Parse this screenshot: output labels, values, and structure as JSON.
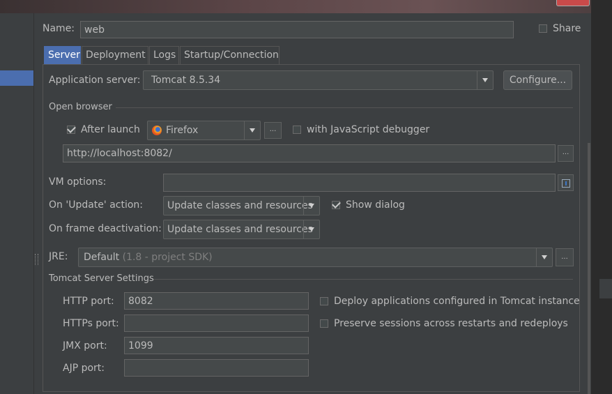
{
  "name_field": {
    "label": "Name:",
    "value": "web"
  },
  "share": {
    "label": "Share",
    "checked": false
  },
  "tabs": [
    {
      "label": "Server",
      "active": true
    },
    {
      "label": "Deployment",
      "active": false
    },
    {
      "label": "Logs",
      "active": false
    },
    {
      "label": "Startup/Connection",
      "active": false
    }
  ],
  "app_server": {
    "label": "Application server:",
    "value": "Tomcat 8.5.34",
    "configure_label": "Configure..."
  },
  "open_browser": {
    "section_title": "Open browser",
    "after_launch_label": "After launch",
    "after_launch_checked": true,
    "browser": "Firefox",
    "ellipsis": "...",
    "js_debugger_label": "with JavaScript debugger",
    "js_debugger_checked": false,
    "url": "http://localhost:8082/"
  },
  "vm_options": {
    "label": "VM options:",
    "value": ""
  },
  "on_update": {
    "label": "On 'Update' action:",
    "value": "Update classes and resources",
    "show_dialog_label": "Show dialog",
    "show_dialog_checked": true
  },
  "on_frame": {
    "label": "On frame deactivation:",
    "value": "Update classes and resources"
  },
  "jre": {
    "label": "JRE:",
    "value": "Default",
    "hint": "(1.8 - project SDK)"
  },
  "tomcat": {
    "section_title": "Tomcat Server Settings",
    "http_label": "HTTP port:",
    "http_value": "8082",
    "https_label": "HTTPs port:",
    "https_value": "",
    "jmx_label": "JMX port:",
    "jmx_value": "1099",
    "ajp_label": "AJP port:",
    "ajp_value": "",
    "deploy_label": "Deploy applications configured in Tomcat instance",
    "preserve_label": "Preserve sessions across restarts and redeploys"
  },
  "colors": {
    "accent": "#4b6eaf",
    "background": "#3c3f41",
    "field": "#45494a"
  }
}
